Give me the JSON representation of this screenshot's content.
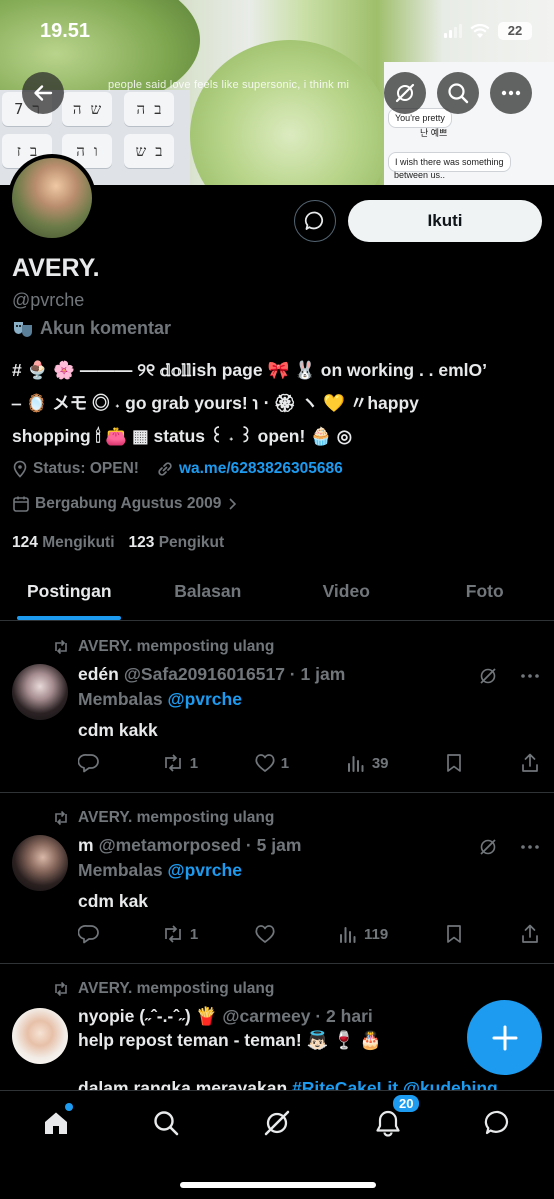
{
  "status_bar": {
    "time": "19.51",
    "battery": "22"
  },
  "banner": {
    "caption": "people said love feels like supersonic, i think mi",
    "keys": [
      "7 ר",
      "ש ה",
      "ב ה",
      "ב ז",
      "ו ה",
      "ב ש"
    ],
    "chat_bubbles": [
      "You're pretty",
      "난 예쁘",
      "I wish there was something",
      "between us.."
    ]
  },
  "profile": {
    "follow_label": "Ikuti",
    "name": "AVERY.",
    "handle": "@pvrche",
    "category": "Akun komentar",
    "bio_lines": [
      "# 🍨 🌸 ——— ୨୧ 𝕕𝕠𝕝𝕝ish page 🎀 🐰 on working . . emlO’",
      "⎯ 🪞 メモ ◎ ˖ go grab yours! ℩ ‧ 🏵 ヽ 💛 〃happy",
      "shopping 🕯 👛 ▦ status ꒰ ˖ ꒱ open! 🧁 ◎"
    ],
    "status": "Status: OPEN!",
    "link": "wa.me/6283826305686",
    "joined": "Bergabung Agustus 2009",
    "following_count": "124",
    "following_label": "Mengikuti",
    "followers_count": "123",
    "followers_label": "Pengikut"
  },
  "tabs": [
    "Postingan",
    "Balasan",
    "Video",
    "Foto"
  ],
  "posts": [
    {
      "repost_label": "AVERY. memposting ulang",
      "name": "edén",
      "meta": "@Safa20916016517 · 1 jam",
      "reply_prefix": "Membalas",
      "reply_mention": "@pvrche",
      "text": "cdm kakk",
      "replies": "",
      "reposts": "1",
      "likes": "1",
      "views": "39"
    },
    {
      "repost_label": "AVERY. memposting ulang",
      "name": "m",
      "meta": "@metamorposed · 5 jam",
      "reply_prefix": "Membalas",
      "reply_mention": "@pvrche",
      "text": "cdm kak",
      "replies": "",
      "reposts": "1",
      "likes": "",
      "views": "119"
    },
    {
      "repost_label": "AVERY. memposting ulang",
      "name": "nyopie (˶ˆ-.-ˆ˶) 🍟",
      "meta": "@carmeey · 2 hari",
      "text": "help repost teman - teman! 👼🏻 🍷 🎂",
      "text2_plain": "dalam rangka merayakan ",
      "text2_link": "#RiteCakeLit @kudebing"
    }
  ],
  "bottom_nav": {
    "notification_badge": "20"
  },
  "colors": {
    "accent": "#1d9bf0",
    "muted": "#71767b",
    "text": "#e7e9ea",
    "border": "#2f3336"
  }
}
